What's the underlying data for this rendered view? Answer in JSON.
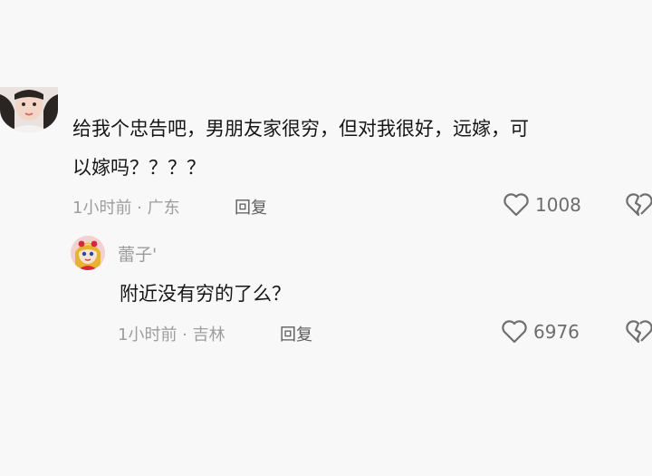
{
  "main_comment": {
    "text_line_1": "给我个忠告吧，男朋友家很穷，但对我很好，远嫁，可",
    "text_line_2": "以嫁吗？？？？",
    "time_location": "1小时前 · 广东",
    "reply_label": "回复",
    "like_count": "1008",
    "avatar_icon": "user-avatar-photo",
    "like_icon": "heart-outline-icon",
    "dislike_icon": "broken-heart-icon"
  },
  "reply_comment": {
    "username": "蕾子'",
    "text": "附近没有穷的了么？",
    "time_location": "1小时前 · 吉林",
    "reply_label": "回复",
    "like_count": "6976",
    "avatar_icon": "cartoon-avatar",
    "like_icon": "heart-outline-icon",
    "dislike_icon": "broken-heart-icon"
  },
  "colors": {
    "background": "#f8f8f8",
    "text_primary": "#161616",
    "text_secondary": "#9d9d9d",
    "reply_label": "#5d5d5d",
    "icon": "#6f6f6f"
  }
}
